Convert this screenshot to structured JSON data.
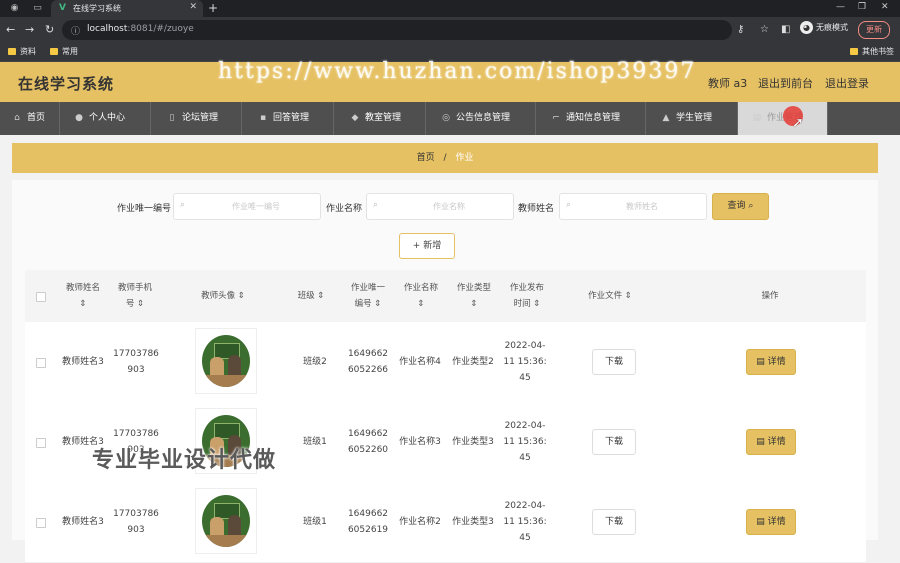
{
  "browser": {
    "tab_title": "在线学习系统",
    "url_host": "localhost",
    "url_rest": ":8081/#/zuoye",
    "incognito_label": "无痕模式",
    "update_label": "更新",
    "bookmarks": [
      "资料",
      "常用"
    ],
    "other_bookmarks": "其他书签"
  },
  "header": {
    "app_name": "在线学习系统",
    "user": "教师 a3",
    "back_to_front": "退出到前台",
    "logout": "退出登录",
    "watermark": "https://www.huzhan.com/ishop39397"
  },
  "nav": {
    "items": [
      {
        "label": "首页",
        "icon": "home-icon"
      },
      {
        "label": "个人中心",
        "icon": "user-icon"
      },
      {
        "label": "论坛管理",
        "icon": "forum-icon"
      },
      {
        "label": "回答管理",
        "icon": "answer-icon"
      },
      {
        "label": "教室管理",
        "icon": "location-icon"
      },
      {
        "label": "公告信息管理",
        "icon": "notice-icon"
      },
      {
        "label": "通知信息管理",
        "icon": "notify-icon"
      },
      {
        "label": "学生管理",
        "icon": "student-icon"
      },
      {
        "label": "作业管理",
        "icon": "homework-icon"
      }
    ]
  },
  "breadcrumb": {
    "home": "首页",
    "separator": "/",
    "current": "作业"
  },
  "search": {
    "field1_label": "作业唯一编号",
    "field1_placeholder": "作业唯一编号",
    "field2_label": "作业名称",
    "field2_placeholder": "作业名称",
    "field3_label": "教师姓名",
    "field3_placeholder": "教师姓名",
    "query_label": "查询",
    "add_label": "+ 新增"
  },
  "table": {
    "columns": [
      "教师姓名",
      "教师手机号",
      "教师头像",
      "班级",
      "作业唯一编号",
      "作业名称",
      "作业类型",
      "作业发布时间",
      "作业文件",
      "操作"
    ],
    "download_label": "下载",
    "detail_label": "详情",
    "rows": [
      {
        "teacher": "教师姓名3",
        "phone": "17703786903",
        "class": "班级2",
        "code": "16496626052266",
        "name": "作业名称4",
        "type": "作业类型2",
        "time": "2022-04-11 15:36:45"
      },
      {
        "teacher": "教师姓名3",
        "phone": "17703786903",
        "class": "班级1",
        "code": "16496626052260",
        "name": "作业名称3",
        "type": "作业类型3",
        "time": "2022-04-11 15:36:45"
      },
      {
        "teacher": "教师姓名3",
        "phone": "17703786903",
        "class": "班级1",
        "code": "16496626052619",
        "name": "作业名称2",
        "type": "作业类型3",
        "time": "2022-04-11 15:36:45"
      }
    ]
  },
  "overlay_text": "专业毕业设计代做",
  "colors": {
    "accent": "#e6c163",
    "nav_bg": "#4f4f4f",
    "chrome_dark": "#202124"
  }
}
